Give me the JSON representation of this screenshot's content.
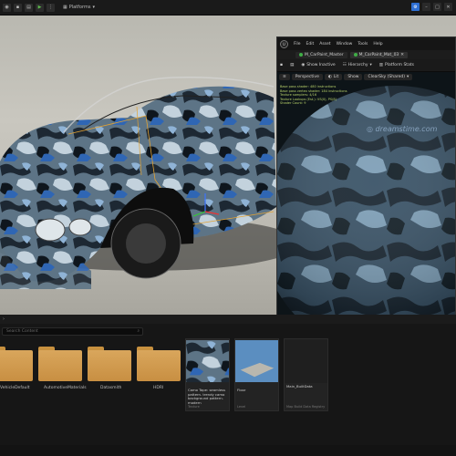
{
  "toolbar": {
    "platforms_label": "Platforms",
    "play_icon": "play-icon",
    "caret": "▾"
  },
  "material_editor": {
    "menu": [
      "File",
      "Edit",
      "Asset",
      "Window",
      "Tools",
      "Help"
    ],
    "tabs": [
      {
        "label": "M_CarPaint_Master"
      },
      {
        "label": "M_CarPaint_Mat_03"
      }
    ],
    "tools": [
      "Show Inactive",
      "Hierarchy",
      "Platform Stats"
    ],
    "viewport_bar": {
      "perspective": "Perspective",
      "lit": "Lit",
      "show": "Show",
      "sky": "ClearSky (Shared)"
    },
    "stats_lines": [
      "Base pass shader: 480 instructions",
      "Base pass vertex shader: 184 instructions",
      "Texture samplers: 4/16",
      "Texture Lookups (Est.): VS(0), PS(8)",
      "Shader Count: 9"
    ],
    "watermark": "dreamstime.com"
  },
  "bottom_panel": {
    "search_placeholder": "Search Content",
    "folders": [
      {
        "label": "VehicleDefault"
      },
      {
        "label": "AutomotiveMaterials"
      },
      {
        "label": "Datasmith"
      },
      {
        "label": "HDRI"
      }
    ],
    "assets": [
      {
        "name": "Camo Tape: seamless pattern. trendy camo background pattern. modern",
        "type": "Texture"
      },
      {
        "name": "Floor",
        "type": "Level"
      },
      {
        "name": "Main_BuiltData",
        "type": "Map Build Data Registry"
      }
    ]
  },
  "material_bottom": {
    "content_drawer": "Content Drawer",
    "output_log": "Output Log",
    "cmd": "Cmd",
    "cmd_placeholder": "Enter Console Command"
  },
  "colors": {
    "accent_blue": "#2e6fd3",
    "tab_green": "#3fae46",
    "folder_yellow": "#d9a65c"
  }
}
